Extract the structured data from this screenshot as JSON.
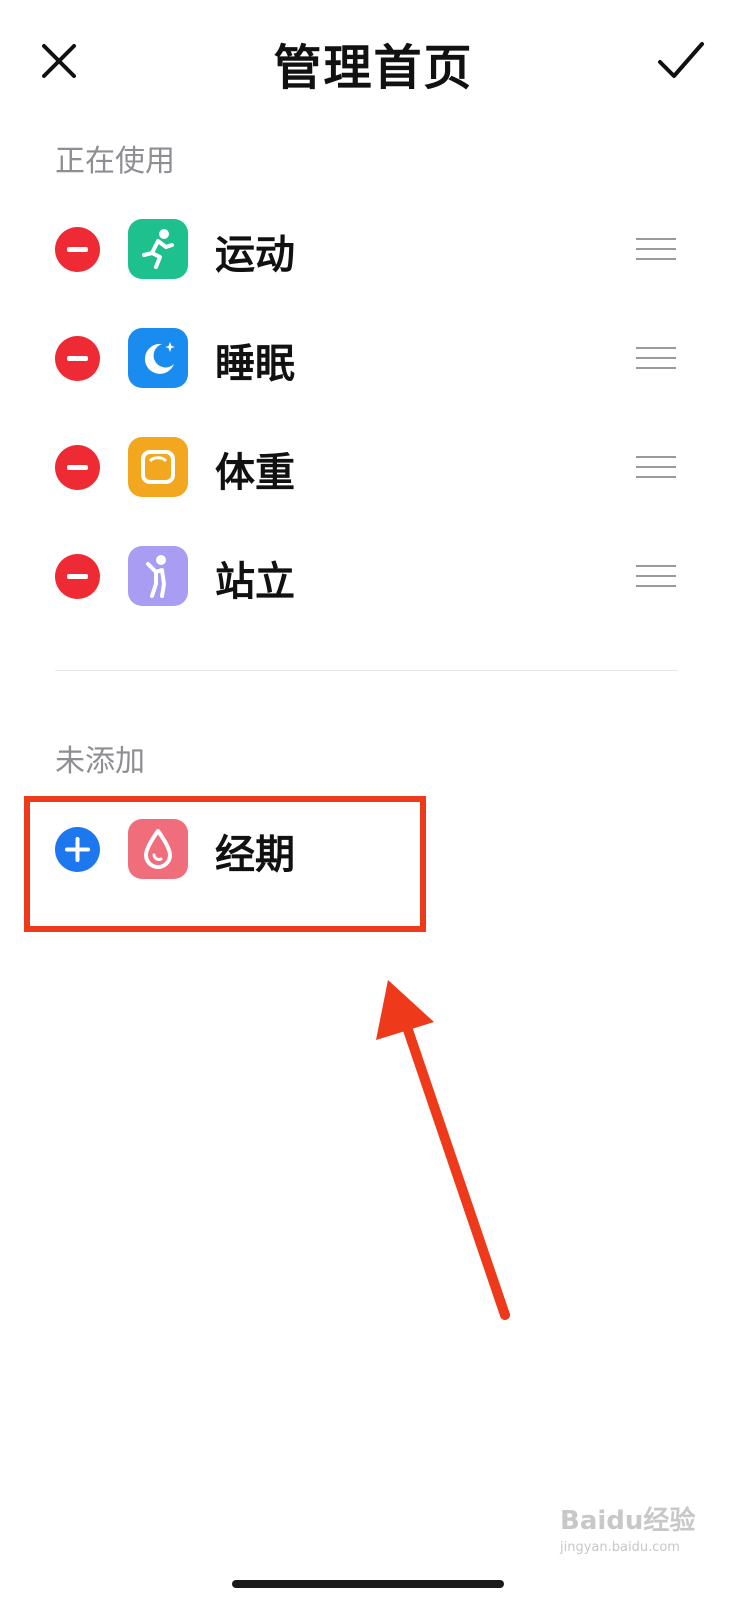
{
  "header": {
    "title": "管理首页",
    "close_icon": "close-icon",
    "confirm_icon": "check-icon"
  },
  "sections": {
    "in_use_label": "正在使用",
    "not_added_label": "未添加"
  },
  "in_use_items": [
    {
      "label": "运动",
      "icon": "running-icon",
      "color": "#1ec08e"
    },
    {
      "label": "睡眠",
      "icon": "moon-icon",
      "color": "#1a8cf0"
    },
    {
      "label": "体重",
      "icon": "scale-icon",
      "color": "#f3a71e"
    },
    {
      "label": "站立",
      "icon": "standing-icon",
      "color": "#a99cf3"
    }
  ],
  "not_added_items": [
    {
      "label": "经期",
      "icon": "drop-icon",
      "color": "#f06e7c"
    }
  ],
  "colors": {
    "remove": "#ee2b35",
    "add": "#1d78f0",
    "annotation": "#ee3a1a"
  },
  "watermark": {
    "text": "Baidu经验",
    "sub": "jingyan.baidu.com"
  }
}
